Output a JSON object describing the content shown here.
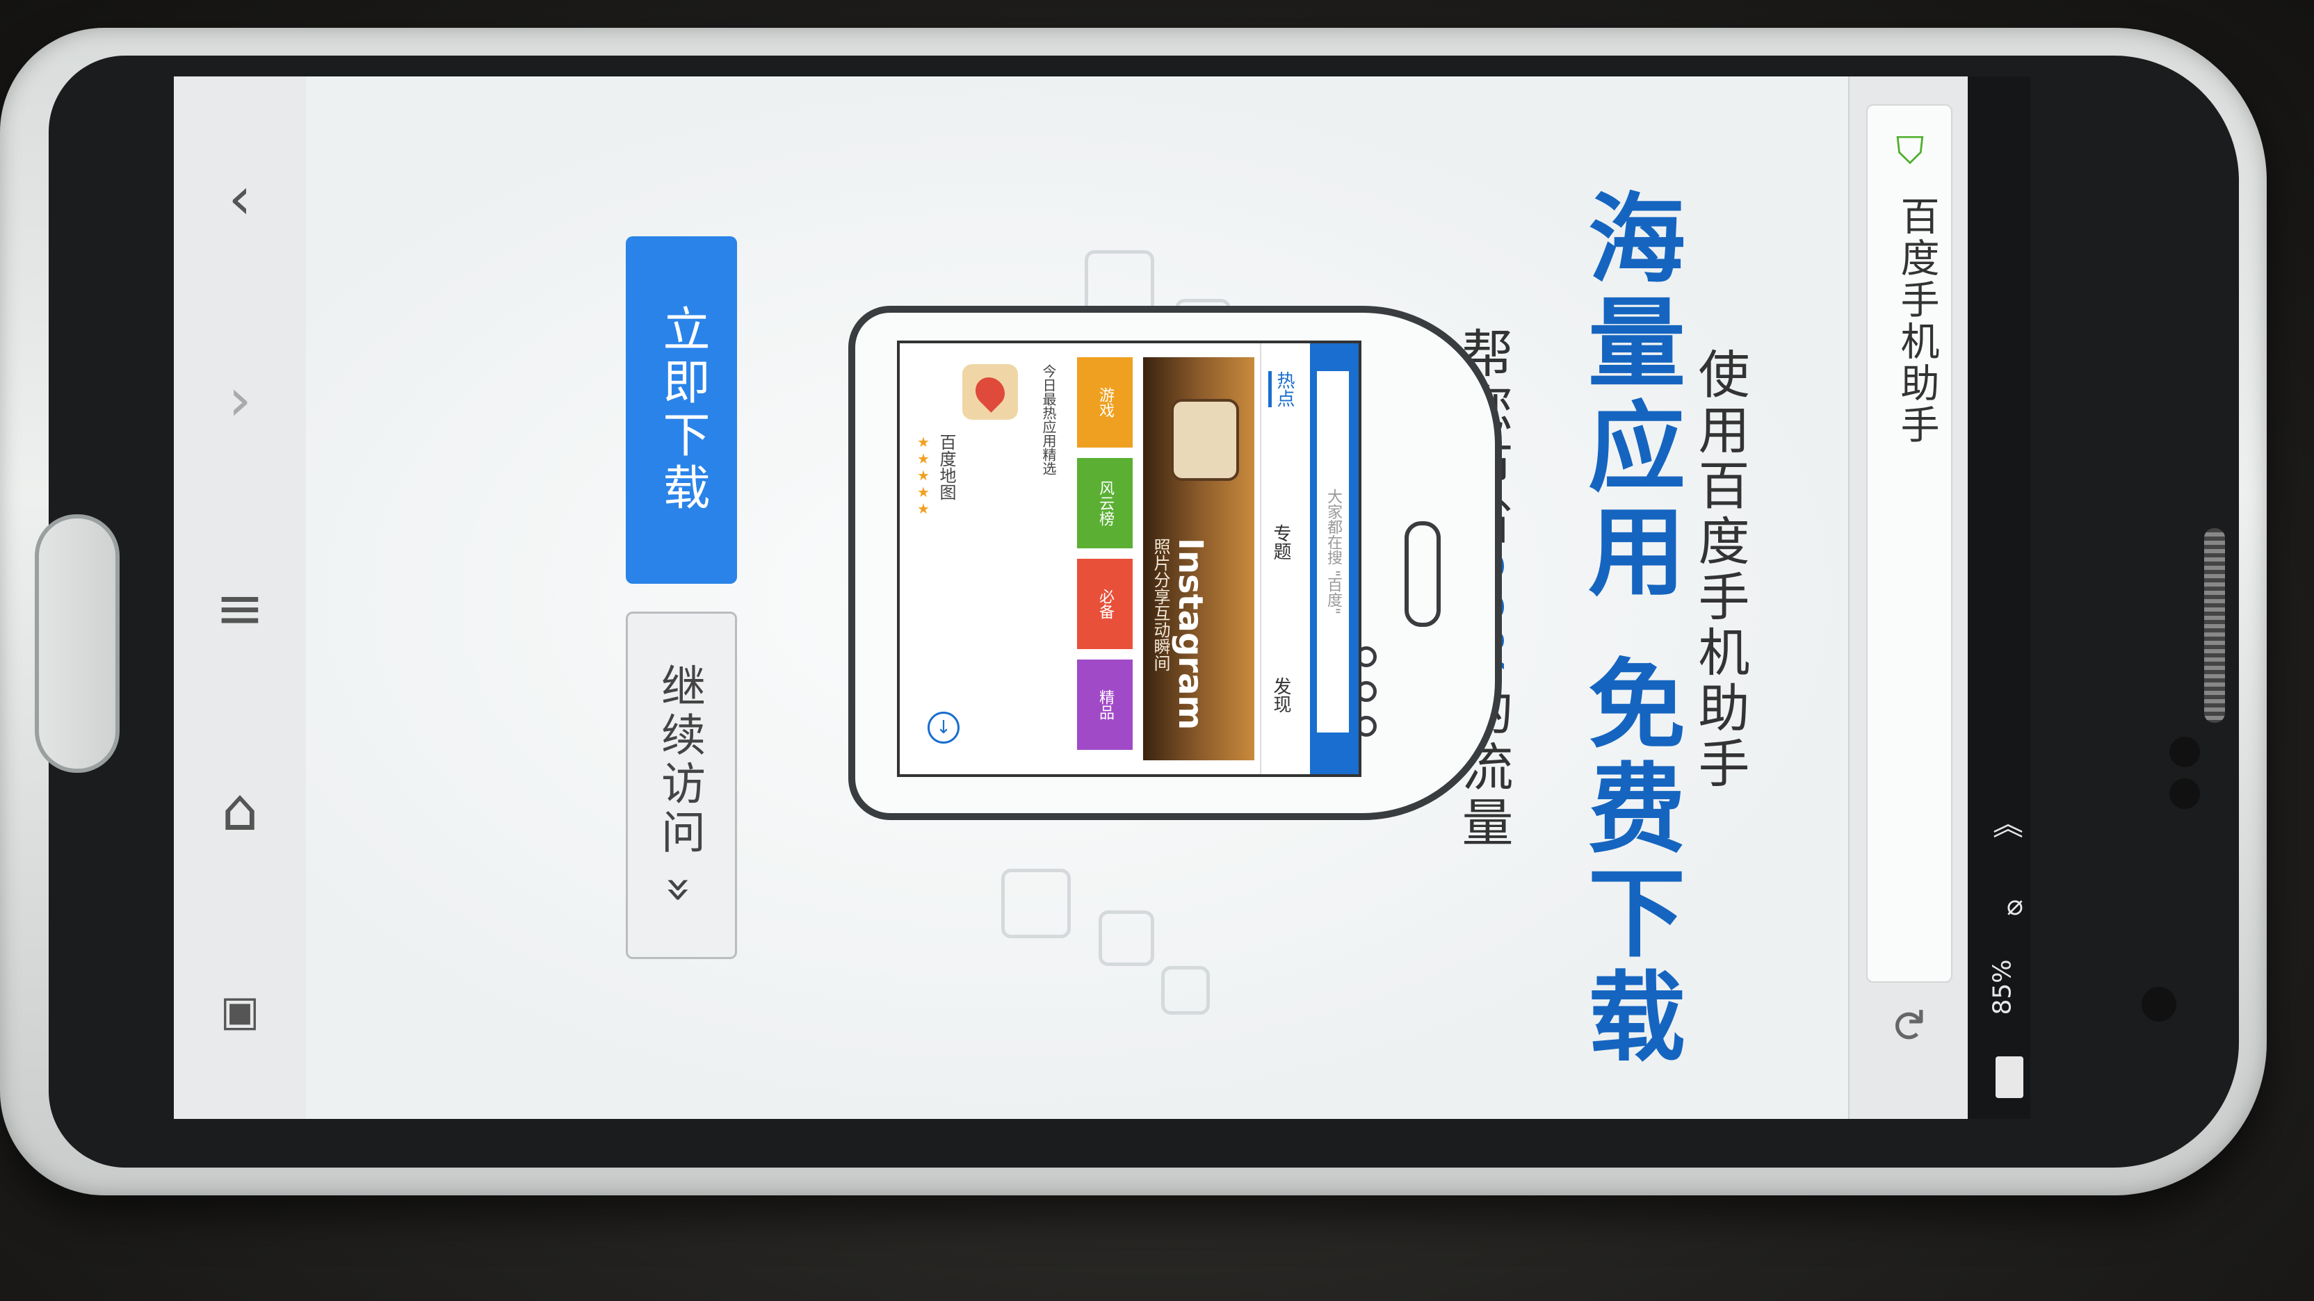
{
  "status_bar": {
    "battery_percent": "85%",
    "signal_icon": "wifi-icon",
    "mute_icon": "mute-icon"
  },
  "address_bar": {
    "page_title": "百度手机助手",
    "security_icon": "shield-icon",
    "reload_icon": "refresh-icon"
  },
  "navigation": {
    "items": [
      {
        "name": "back",
        "glyph": "‹"
      },
      {
        "name": "forward",
        "glyph": "›"
      },
      {
        "name": "menu",
        "glyph": "≡"
      },
      {
        "name": "home",
        "glyph": "⌂"
      },
      {
        "name": "tabs",
        "glyph": "1"
      }
    ]
  },
  "promo": {
    "subtitle": "使用百度手机助手",
    "headline_part1": "海量应用",
    "headline_part2": "免费下载",
    "tagline_prefix": "帮您节省",
    "tagline_highlight": "90%",
    "tagline_suffix": "的流量",
    "download_button": "立即下载",
    "continue_button": "继续访问 »",
    "accent_color": "#1565c0",
    "button_color": "#2a83e8"
  },
  "illustration": {
    "search_placeholder": "大家都在搜 \"百度\"",
    "tabs": [
      "热点",
      "专题",
      "发现"
    ],
    "banner_title": "Instagram",
    "banner_subtitle": "照片分享互动瞬间",
    "categories": [
      {
        "label": "游戏",
        "color": "#f0a020"
      },
      {
        "label": "风云榜",
        "color": "#5bb034"
      },
      {
        "label": "必备",
        "color": "#e8503a"
      },
      {
        "label": "精品",
        "color": "#a04ac8"
      }
    ],
    "list_header": "今日最热应用精选",
    "list_app_name": "百度地图",
    "list_app_meta": "★★★★★"
  }
}
